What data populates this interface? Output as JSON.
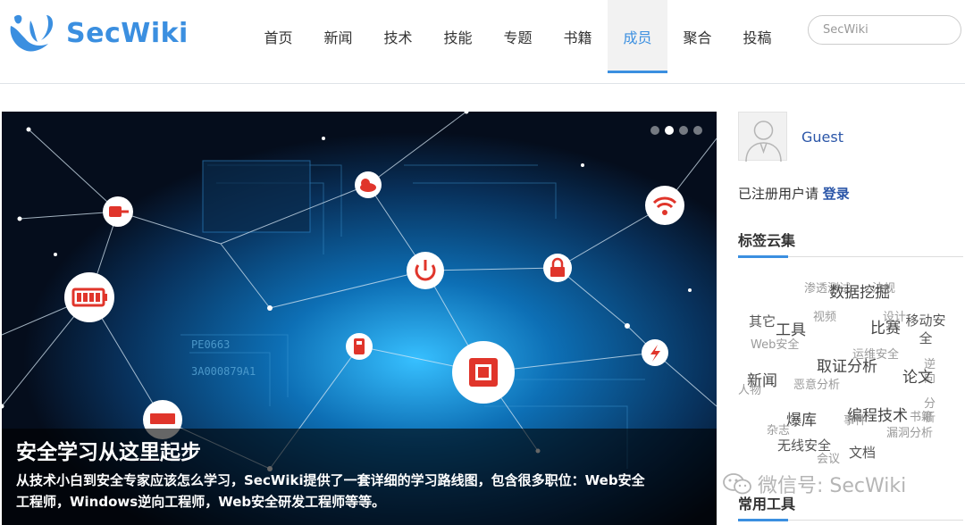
{
  "header": {
    "logo_text": "SecWiki",
    "nav": [
      "首页",
      "新闻",
      "技术",
      "技能",
      "专题",
      "书籍",
      "成员",
      "聚合",
      "投稿"
    ],
    "active_nav_index": 6,
    "search_placeholder": "SecWiki",
    "accent_color": "#3b8fe0"
  },
  "banner": {
    "title": "安全学习从这里起步",
    "text_line1": "从技术小白到安全专家应该怎么学习，SecWiki提供了一套详细的学习路线图，包含很多职位：Web安全",
    "text_line2": "工程师，Windows逆向工程师，Web安全研发工程师等等。",
    "pcb_text1": "PE0663",
    "pcb_text2": "3A000879A1",
    "slide_count": 4,
    "active_slide": 1
  },
  "sidebar": {
    "username": "Guest",
    "login_prefix": "已注册用户请",
    "login_link": "登录",
    "tag_cloud_title": "标签云集",
    "tools_title": "常用工具",
    "tags": [
      "渗透测试",
      "法规",
      "数据挖掘",
      "视频",
      "设计",
      "移动安全",
      "其它",
      "工具",
      "比赛",
      "Web安全",
      "运维安全",
      "取证分析",
      "逆向",
      "论文",
      "分析",
      "新闻",
      "恶意分析",
      "人物",
      "编程技术",
      "书籍",
      "爆库",
      "事件",
      "杂志",
      "漏洞分析",
      "无线安全",
      "文档",
      "会议"
    ]
  },
  "watermark": {
    "text": "微信号: SecWiki"
  }
}
